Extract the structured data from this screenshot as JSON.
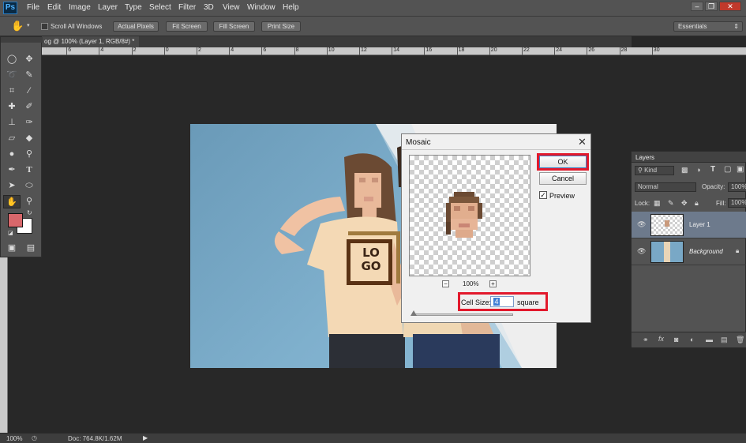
{
  "app": {
    "logo": "Ps",
    "brand_color": "#31a8ff"
  },
  "menu": [
    "File",
    "Edit",
    "Image",
    "Layer",
    "Type",
    "Select",
    "Filter",
    "3D",
    "View",
    "Window",
    "Help"
  ],
  "options_bar": {
    "scroll_all_label": "Scroll All Windows",
    "buttons": [
      "Actual Pixels",
      "Fit Screen",
      "Fill Screen",
      "Print Size"
    ],
    "workspace": "Essentials"
  },
  "document": {
    "tab_title": "og @ 100% (Layer 1, RGB/8#) *"
  },
  "ruler": {
    "top_labels": [
      "8",
      "6",
      "4",
      "2",
      "0",
      "2",
      "4",
      "6",
      "8",
      "10",
      "12",
      "14",
      "16",
      "18",
      "20",
      "22",
      "24",
      "26",
      "28",
      "30"
    ]
  },
  "tools": {
    "foreground_color": "#d8676b",
    "background_color": "#ffffff"
  },
  "status": {
    "zoom": "100%",
    "doc": "Doc: 764.8K/1.62M"
  },
  "canvas": {
    "logo_letters": [
      "L",
      "O",
      "G",
      "O"
    ]
  },
  "dialog": {
    "title": "Mosaic",
    "ok_label": "OK",
    "cancel_label": "Cancel",
    "preview_label": "Preview",
    "preview_checked": true,
    "zoom": "100%",
    "zoom_out": "−",
    "zoom_in": "+",
    "cell_size_label": "Cell Size:",
    "cell_size_value": "4",
    "cell_unit": "square"
  },
  "layers_panel": {
    "title": "Layers",
    "kind_label": "Kind",
    "blend_mode": "Normal",
    "opacity_label": "Opacity:",
    "opacity_value": "100%",
    "lock_label": "Lock:",
    "fill_label": "Fill:",
    "fill_value": "100%",
    "layers": [
      {
        "name": "Layer 1",
        "selected": true
      },
      {
        "name": "Background",
        "selected": false
      }
    ]
  }
}
